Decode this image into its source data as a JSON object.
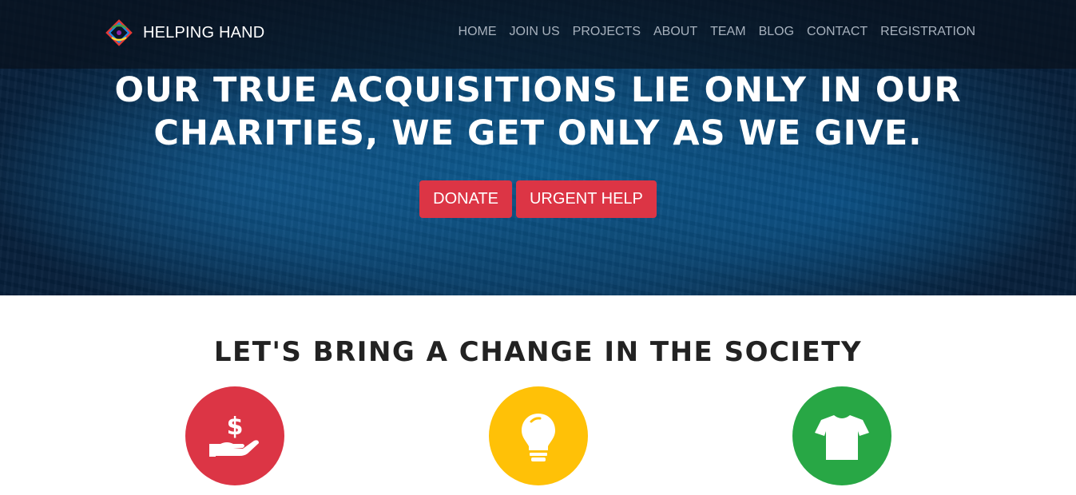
{
  "brand": {
    "name": "HELPING HAND",
    "logo_icon": "colorful-diamond-logo"
  },
  "nav": {
    "items": [
      "HOME",
      "JOIN US",
      "PROJECTS",
      "ABOUT",
      "TEAM",
      "BLOG",
      "CONTACT",
      "REGISTRATION"
    ]
  },
  "hero": {
    "headline_line1": "OUR TRUE ACQUISITIONS LIE ONLY IN OUR",
    "headline_line2": "CHARITIES, WE GET ONLY AS WE GIVE.",
    "donate_label": "DONATE",
    "urgent_label": "URGENT HELP"
  },
  "section": {
    "title": "LET'S BRING A CHANGE IN THE SOCIETY"
  },
  "features": [
    {
      "icon": "hand-dollar-icon",
      "color": "#dc3545"
    },
    {
      "icon": "lightbulb-icon",
      "color": "#ffc107"
    },
    {
      "icon": "tshirt-icon",
      "color": "#28a745"
    }
  ],
  "colors": {
    "accent": "#dc3545",
    "hero_dark": "#061f3a",
    "hero_blue": "#0c5a8f"
  }
}
